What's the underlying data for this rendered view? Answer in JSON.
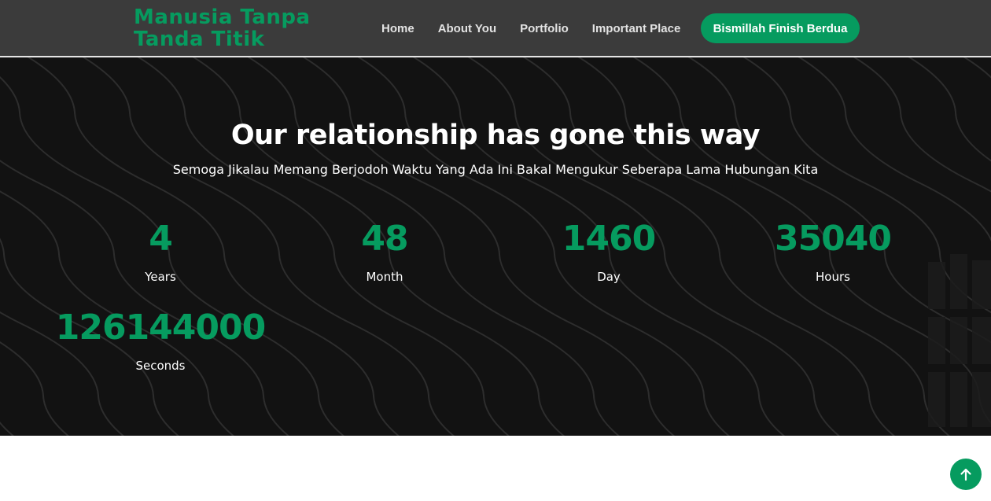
{
  "nav": {
    "brand": "Manusia Tanpa Tanda Titik",
    "links": [
      "Home",
      "About You",
      "Portfolio",
      "Important Place"
    ],
    "cta_label": "Bismillah Finish Berdua"
  },
  "hero": {
    "title": "Our relationship has gone this way",
    "subtitle": "Semoga Jikalau Memang Berjodoh Waktu Yang Ada Ini Bakal Mengukur Seberapa Lama Hubungan Kita",
    "counters": [
      {
        "value": "4",
        "label": "Years"
      },
      {
        "value": "48",
        "label": "Month"
      },
      {
        "value": "1460",
        "label": "Day"
      },
      {
        "value": "35040",
        "label": "Hours"
      },
      {
        "value": "126144000",
        "label": "Seconds"
      }
    ]
  },
  "icons": {
    "scroll_top": "arrow-up-icon"
  },
  "colors": {
    "accent": "#069b5f",
    "navbar_bg": "#3b3b3b",
    "hero_bg": "#121212",
    "text_light": "#ffffff"
  }
}
